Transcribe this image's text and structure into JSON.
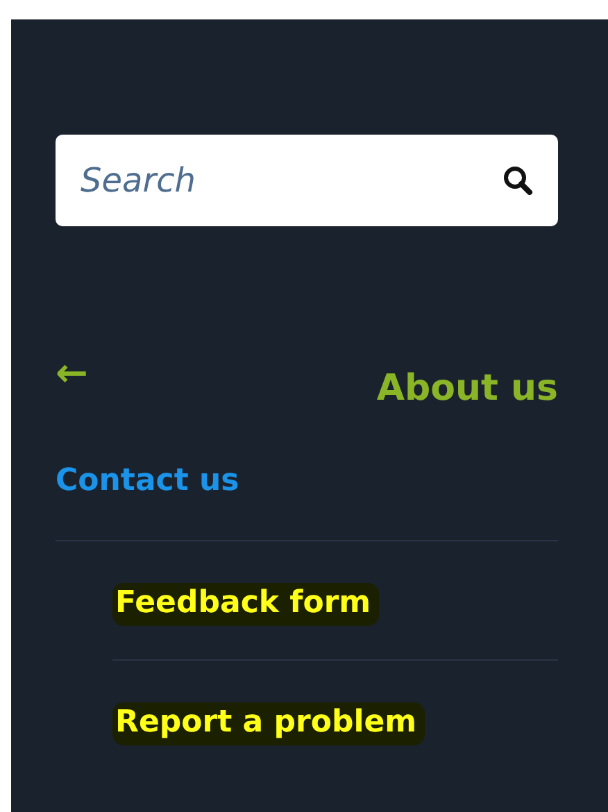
{
  "search": {
    "placeholder": "Search"
  },
  "back": {
    "icon": "←"
  },
  "heading": "About us",
  "menu": [
    {
      "label": "Contact us",
      "expanded": true,
      "children": [
        {
          "label": "Feedback form",
          "highlighted": true
        },
        {
          "label": "Report a problem",
          "highlighted": true
        }
      ]
    }
  ]
}
